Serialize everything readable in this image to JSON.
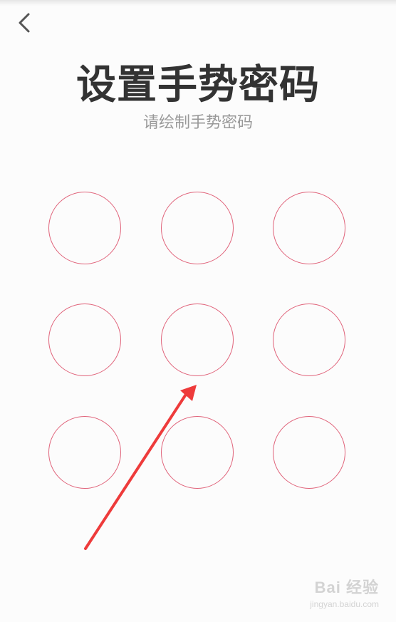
{
  "header": {
    "back_icon": "chevron-left-icon"
  },
  "main": {
    "title": "设置手势密码",
    "subtitle": "请绘制手势密码"
  },
  "pattern": {
    "rows": 3,
    "cols": 3,
    "ring_color": "#e0637a",
    "nodes": [
      {
        "id": "1"
      },
      {
        "id": "2"
      },
      {
        "id": "3"
      },
      {
        "id": "4"
      },
      {
        "id": "5"
      },
      {
        "id": "6"
      },
      {
        "id": "7"
      },
      {
        "id": "8"
      },
      {
        "id": "9"
      }
    ]
  },
  "annotation": {
    "arrow_color": "#ee3b3b",
    "points_to": "5"
  },
  "watermark": {
    "brand": "Bai 经验",
    "url": "jingyan.baidu.com"
  }
}
